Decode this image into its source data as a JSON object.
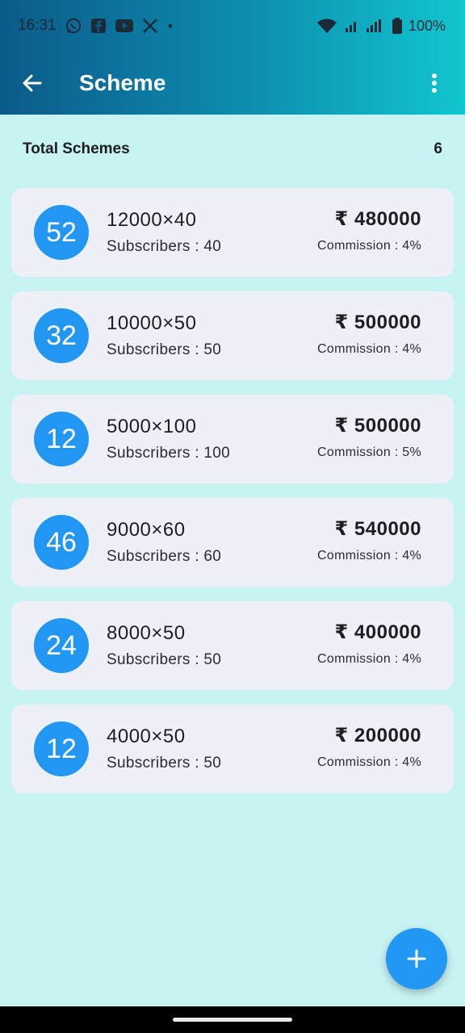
{
  "status_bar": {
    "time": "16:31",
    "battery": "100%",
    "icons": [
      "whatsapp-icon",
      "facebook-icon",
      "youtube-icon",
      "x-icon",
      "dot-icon",
      "wifi-icon",
      "signal-icon",
      "battery-icon"
    ]
  },
  "app_bar": {
    "title": "Scheme",
    "gradient_from": "#0b5a8a",
    "gradient_to": "#11c6cf"
  },
  "summary": {
    "label": "Total Schemes",
    "count": "6"
  },
  "schemes": [
    {
      "badge": "52",
      "name": "12000×40",
      "subscribers": "Subscribers : 40",
      "amount": "₹ 480000",
      "commission": "Commission : 4%"
    },
    {
      "badge": "32",
      "name": "10000×50",
      "subscribers": "Subscribers : 50",
      "amount": "₹ 500000",
      "commission": "Commission : 4%"
    },
    {
      "badge": "12",
      "name": "5000×100",
      "subscribers": "Subscribers : 100",
      "amount": "₹ 500000",
      "commission": "Commission : 5%"
    },
    {
      "badge": "46",
      "name": "9000×60",
      "subscribers": "Subscribers : 60",
      "amount": "₹ 540000",
      "commission": "Commission : 4%"
    },
    {
      "badge": "24",
      "name": "8000×50",
      "subscribers": "Subscribers : 50",
      "amount": "₹ 400000",
      "commission": "Commission : 4%"
    },
    {
      "badge": "12",
      "name": "4000×50",
      "subscribers": "Subscribers : 50",
      "amount": "₹ 200000",
      "commission": "Commission : 4%"
    }
  ],
  "colors": {
    "background": "#c8f3f3",
    "card": "#eef0f8",
    "accent": "#2196f3"
  }
}
